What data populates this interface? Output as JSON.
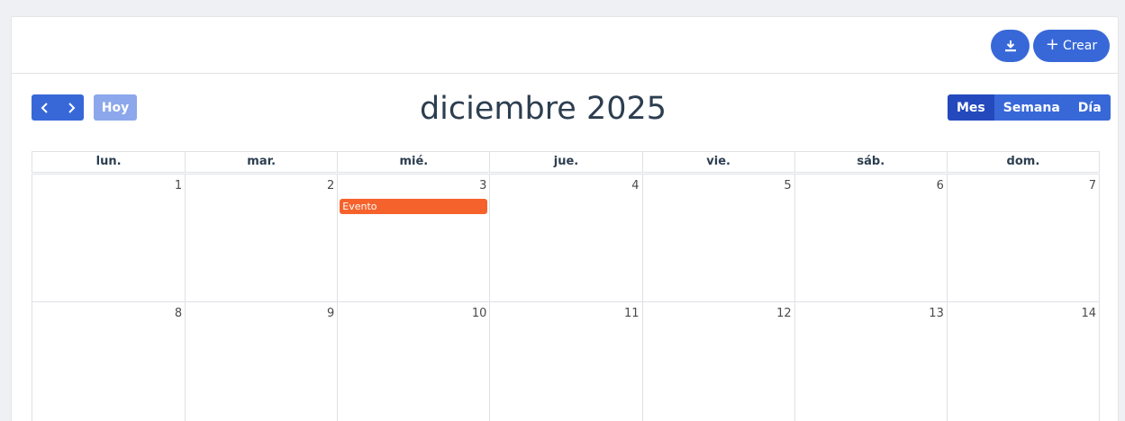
{
  "toolbar": {
    "download_icon": "download-icon",
    "create_label": "Crear",
    "create_icon": "+"
  },
  "calendar": {
    "title": "diciembre 2025",
    "today_label": "Hoy",
    "prev_icon": "chevron-left-icon",
    "next_icon": "chevron-right-icon",
    "views": [
      "Mes",
      "Semana",
      "Día"
    ],
    "active_view": "Mes",
    "weekdays": [
      "lun.",
      "mar.",
      "mié.",
      "jue.",
      "vie.",
      "sáb.",
      "dom."
    ],
    "weeks": [
      [
        "1",
        "2",
        "3",
        "4",
        "5",
        "6",
        "7"
      ],
      [
        "8",
        "9",
        "10",
        "11",
        "12",
        "13",
        "14"
      ]
    ],
    "events": [
      {
        "label": "Evento",
        "day": "3",
        "color": "#f6622b"
      }
    ]
  },
  "colors": {
    "primary": "#3868d8",
    "primary_active": "#2349bd",
    "today_button": "#8ca7eb",
    "title_text": "#2c3e50",
    "event": "#f6622b"
  }
}
